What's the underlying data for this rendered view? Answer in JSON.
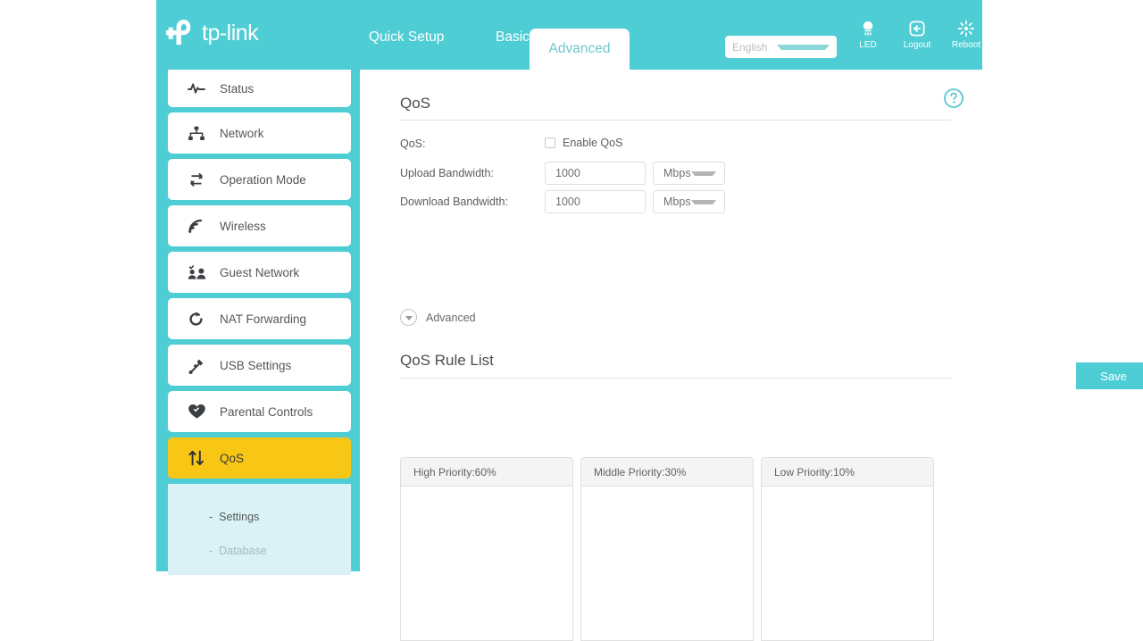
{
  "brand": {
    "name": "tp-link",
    "logo_icon": "tplink-logo"
  },
  "theme": {
    "teal": "#4ECDD4",
    "active_menu": "#F8C716",
    "submenu_bg": "#DAF2F5",
    "text_gray": "#5a5d60"
  },
  "header": {
    "tabs": [
      {
        "label": "Quick Setup",
        "active": false
      },
      {
        "label": "Basic",
        "active": false
      },
      {
        "label": "Advanced",
        "active": true
      }
    ],
    "language": {
      "value": "English",
      "caret_icon": "chevron-down-icon"
    },
    "actions": [
      {
        "label": "LED",
        "icon": "led-bulb-icon"
      },
      {
        "label": "Logout",
        "icon": "logout-icon"
      },
      {
        "label": "Reboot",
        "icon": "reboot-icon"
      }
    ]
  },
  "sidebar": {
    "items": [
      {
        "label": "Status",
        "icon": "pulse-icon",
        "active": false
      },
      {
        "label": "Network",
        "icon": "network-tree-icon",
        "active": false
      },
      {
        "label": "Operation Mode",
        "icon": "operation-mode-icon",
        "active": false
      },
      {
        "label": "Wireless",
        "icon": "wireless-signal-icon",
        "active": false
      },
      {
        "label": "Guest Network",
        "icon": "guest-users-icon",
        "active": false
      },
      {
        "label": "NAT Forwarding",
        "icon": "nat-forwarding-icon",
        "active": false
      },
      {
        "label": "USB Settings",
        "icon": "usb-icon",
        "active": false
      },
      {
        "label": "Parental Controls",
        "icon": "heart-icon",
        "active": false
      },
      {
        "label": "QoS",
        "icon": "updown-arrows-icon",
        "active": true
      }
    ],
    "subitems": [
      {
        "label": "Settings",
        "dash": "-",
        "active": true
      },
      {
        "label": "Database",
        "dash": "-",
        "active": false
      }
    ]
  },
  "main": {
    "help_icon": "question-circle-icon",
    "qos_section": {
      "title": "QoS",
      "qos_label": "QoS:",
      "enable_checkbox": {
        "label": "Enable QoS",
        "checked": false
      },
      "upload": {
        "label": "Upload Bandwidth:",
        "value": "1000",
        "unit": "Mbps",
        "caret_icon": "chevron-down-icon"
      },
      "download": {
        "label": "Download Bandwidth:",
        "value": "1000",
        "unit": "Mbps",
        "caret_icon": "chevron-down-icon"
      },
      "advanced_toggle": {
        "label": "Advanced",
        "icon": "chevron-down-circle-icon"
      },
      "save_button": "Save"
    },
    "rule_list": {
      "title": "QoS Rule List",
      "columns": [
        {
          "header": "High Priority:60%",
          "rows": []
        },
        {
          "header": "Middle Priority:30%",
          "rows": []
        },
        {
          "header": "Low Priority:10%",
          "rows": []
        }
      ]
    }
  }
}
